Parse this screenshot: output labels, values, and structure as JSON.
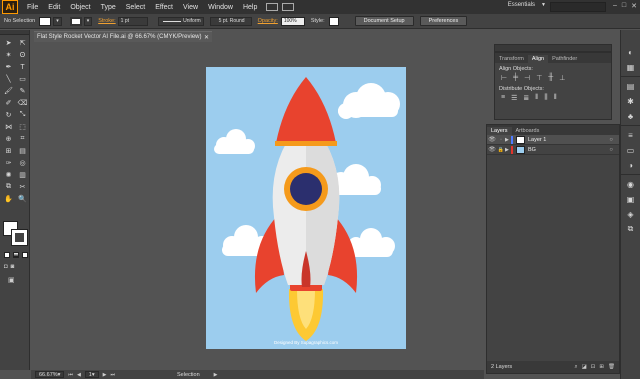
{
  "app": {
    "logo": "Ai",
    "menus": [
      "File",
      "Edit",
      "Object",
      "Type",
      "Select",
      "Effect",
      "View",
      "Window",
      "Help"
    ],
    "workspace": "Essentials",
    "window_controls": [
      "–",
      "□",
      "✕"
    ]
  },
  "control_bar": {
    "selection_label": "No Selection",
    "stroke_link": "Stroke:",
    "stroke_weight": "1 pt",
    "stroke_profile": "Uniform",
    "brush": "5 pt. Round",
    "opacity_link": "Opacity:",
    "opacity_value": "100%",
    "style_label": "Style:",
    "document_setup": "Document Setup",
    "preferences": "Preferences"
  },
  "document": {
    "tab_title": "Flat Style Rocket Vector AI File.ai @ 66.67% (CMYK/Preview)",
    "close": "✕",
    "watermark": "Designed By Supagraphics.com"
  },
  "colors": {
    "sky": "#9ccdee",
    "rocket_body": "#ececec",
    "rocket_red": "#e8432e",
    "window_ring": "#f59a1b",
    "window_glass": "#2b2f6e",
    "flame_outer": "#fdc933",
    "flame_inner": "#fee07a"
  },
  "status_bar": {
    "zoom": "66.67%",
    "artboard_number": "1",
    "status": "Selection"
  },
  "align_panel": {
    "tabs": [
      "Transform",
      "Align",
      "Pathfinder"
    ],
    "align_objects": "Align Objects:",
    "distribute_objects": "Distribute Objects:"
  },
  "layers_panel": {
    "tabs": [
      "Layers",
      "Artboards"
    ],
    "layers": [
      {
        "name": "Layer 1",
        "color": "#4f7bff"
      },
      {
        "name": "BG",
        "color": "#e0342c"
      }
    ],
    "footer": "2 Layers"
  }
}
